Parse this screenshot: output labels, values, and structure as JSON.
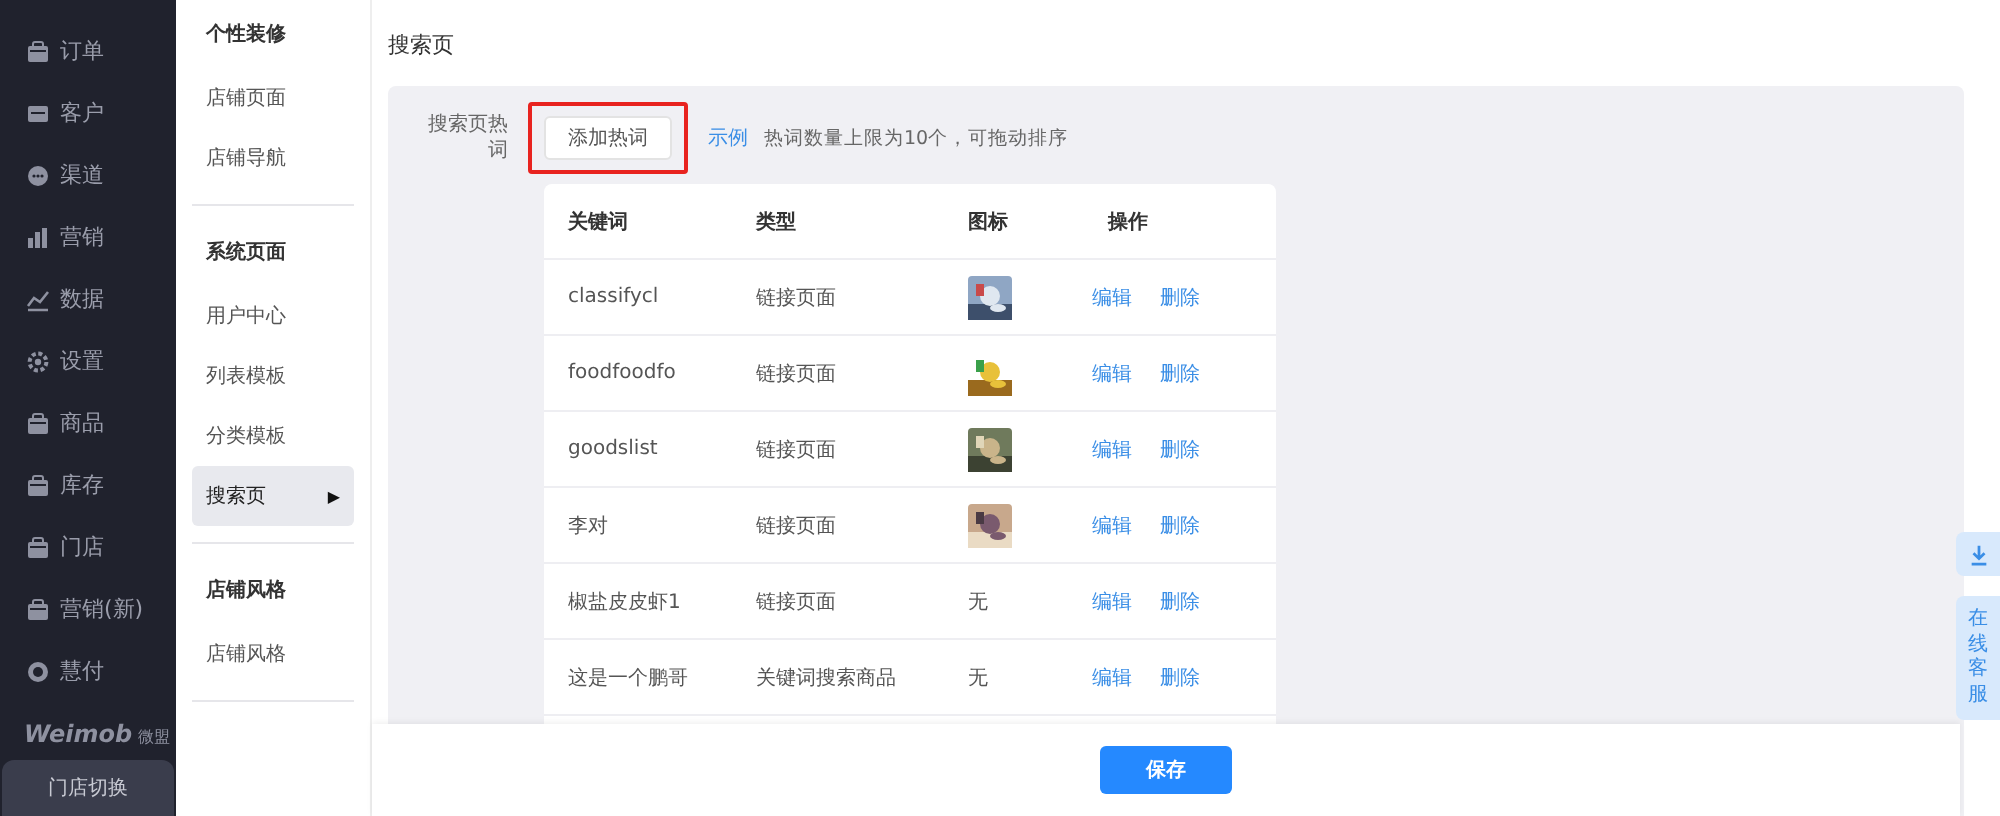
{
  "nav": {
    "items": [
      {
        "label": "订单",
        "kind": "box"
      },
      {
        "label": "客户",
        "kind": "card"
      },
      {
        "label": "渠道",
        "kind": "chat"
      },
      {
        "label": "营销",
        "kind": "bars"
      },
      {
        "label": "数据",
        "kind": "line"
      },
      {
        "label": "设置",
        "kind": "gear"
      },
      {
        "label": "商品",
        "kind": "box"
      },
      {
        "label": "库存",
        "kind": "box"
      },
      {
        "label": "门店",
        "kind": "box"
      },
      {
        "label": "营销(新)",
        "kind": "box"
      },
      {
        "label": "慧付",
        "kind": "dot"
      }
    ],
    "logo": {
      "brand": "Weimob",
      "sub": "微盟"
    },
    "switch_button": "门店切换"
  },
  "subnav": {
    "sections": [
      {
        "title": "个性装修",
        "items": [
          {
            "label": "店铺页面",
            "selected": false
          },
          {
            "label": "店铺导航",
            "selected": false
          }
        ]
      },
      {
        "title": "系统页面",
        "items": [
          {
            "label": "用户中心",
            "selected": false
          },
          {
            "label": "列表模板",
            "selected": false
          },
          {
            "label": "分类模板",
            "selected": false
          },
          {
            "label": "搜索页",
            "selected": true
          }
        ]
      },
      {
        "title": "店铺风格",
        "items": [
          {
            "label": "店铺风格",
            "selected": false
          }
        ]
      }
    ],
    "caret": "▶"
  },
  "page": {
    "title": "搜索页",
    "field_label": "搜索页热词",
    "add_button": "添加热词",
    "example_link": "示例",
    "hint": "热词数量上限为10个，可拖动排序",
    "table": {
      "columns": [
        "关键词",
        "类型",
        "图标",
        "操作"
      ],
      "rows": [
        {
          "keyword": "classifycl",
          "type": "链接页面",
          "icon": {
            "kind": "picture"
          },
          "actions": [
            "编辑",
            "删除"
          ]
        },
        {
          "keyword": "foodfoodfo",
          "type": "链接页面",
          "icon": {
            "kind": "picture"
          },
          "actions": [
            "编辑",
            "删除"
          ]
        },
        {
          "keyword": "goodslist",
          "type": "链接页面",
          "icon": {
            "kind": "picture"
          },
          "actions": [
            "编辑",
            "删除"
          ]
        },
        {
          "keyword": "李对",
          "type": "链接页面",
          "icon": {
            "kind": "picture"
          },
          "actions": [
            "编辑",
            "删除"
          ]
        },
        {
          "keyword": "椒盐皮皮虾1",
          "type": "链接页面",
          "icon": {
            "kind": "text",
            "text": "无"
          },
          "actions": [
            "编辑",
            "删除"
          ]
        },
        {
          "keyword": "这是一个鹏哥",
          "type": "关键词搜索商品",
          "icon": {
            "kind": "text",
            "text": "无"
          },
          "actions": [
            "编辑",
            "删除"
          ]
        }
      ]
    },
    "save_button": "保存"
  },
  "float_buttons": {
    "service": "在线客服"
  }
}
